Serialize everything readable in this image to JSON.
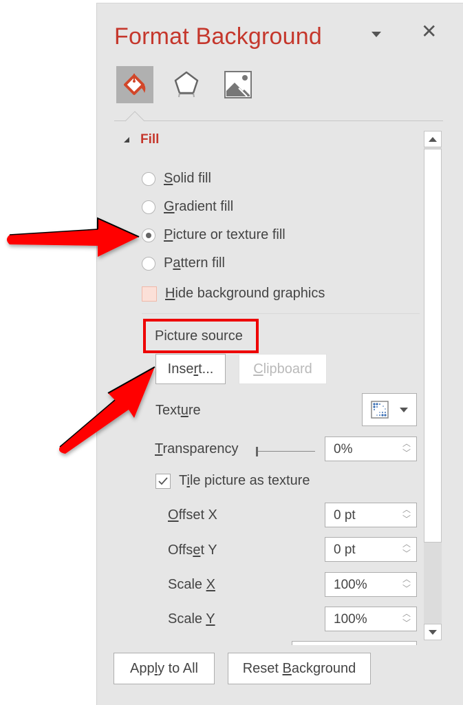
{
  "pane": {
    "title": "Format Background",
    "tabs": [
      {
        "name": "fill-tab",
        "icon": "paint-bucket-icon",
        "active": true
      },
      {
        "name": "effects-tab",
        "icon": "pentagon-icon",
        "active": false
      },
      {
        "name": "picture-tab",
        "icon": "picture-icon",
        "active": false
      }
    ],
    "section": {
      "label": "Fill",
      "expanded": true
    },
    "fill_options": [
      {
        "pre": "",
        "ul": "S",
        "post": "olid fill",
        "selected": false
      },
      {
        "pre": "",
        "ul": "G",
        "post": "radient fill",
        "selected": false
      },
      {
        "pre": "",
        "ul": "P",
        "post": "icture or texture fill",
        "selected": true
      },
      {
        "pre": "P",
        "ul": "a",
        "post": "ttern fill",
        "selected": false
      }
    ],
    "hide_bg": {
      "pre": "",
      "ul": "H",
      "post": "ide background graphics",
      "checked": false
    },
    "picture_source": {
      "label": "Picture source",
      "insert": {
        "pre": "Inse",
        "ul": "r",
        "post": "t..."
      },
      "clipboard": {
        "pre": "",
        "ul": "C",
        "post": "lipboard",
        "enabled": false
      }
    },
    "texture": {
      "pre": "Text",
      "ul": "u",
      "post": "re"
    },
    "transparency": {
      "pre": "",
      "ul": "T",
      "post": "ransparency",
      "value": "0%",
      "level_percent": 0
    },
    "tile": {
      "pre": "T",
      "ul": "i",
      "post": "le picture as texture",
      "checked": true
    },
    "fields": [
      {
        "pre": "",
        "ul": "O",
        "post": "ffset X",
        "value": "0 pt"
      },
      {
        "pre": "Offs",
        "ul": "e",
        "post": "t Y",
        "value": "0 pt"
      },
      {
        "pre": "Scale ",
        "ul": "X",
        "post": "",
        "value": "100%"
      },
      {
        "pre": "Scale ",
        "ul": "Y",
        "post": "",
        "value": "100%"
      }
    ],
    "footer": {
      "apply_all": {
        "pre": "App",
        "ul": "l",
        "post": "y to All"
      },
      "reset": {
        "pre": "Reset ",
        "ul": "B",
        "post": "ackground"
      }
    }
  },
  "annotations": {
    "arrow_color": "#ff0000",
    "highlight_box_color": "#ee0000"
  },
  "colors": {
    "accent": "#c5372c",
    "pane_bg": "#e6e6e6"
  }
}
